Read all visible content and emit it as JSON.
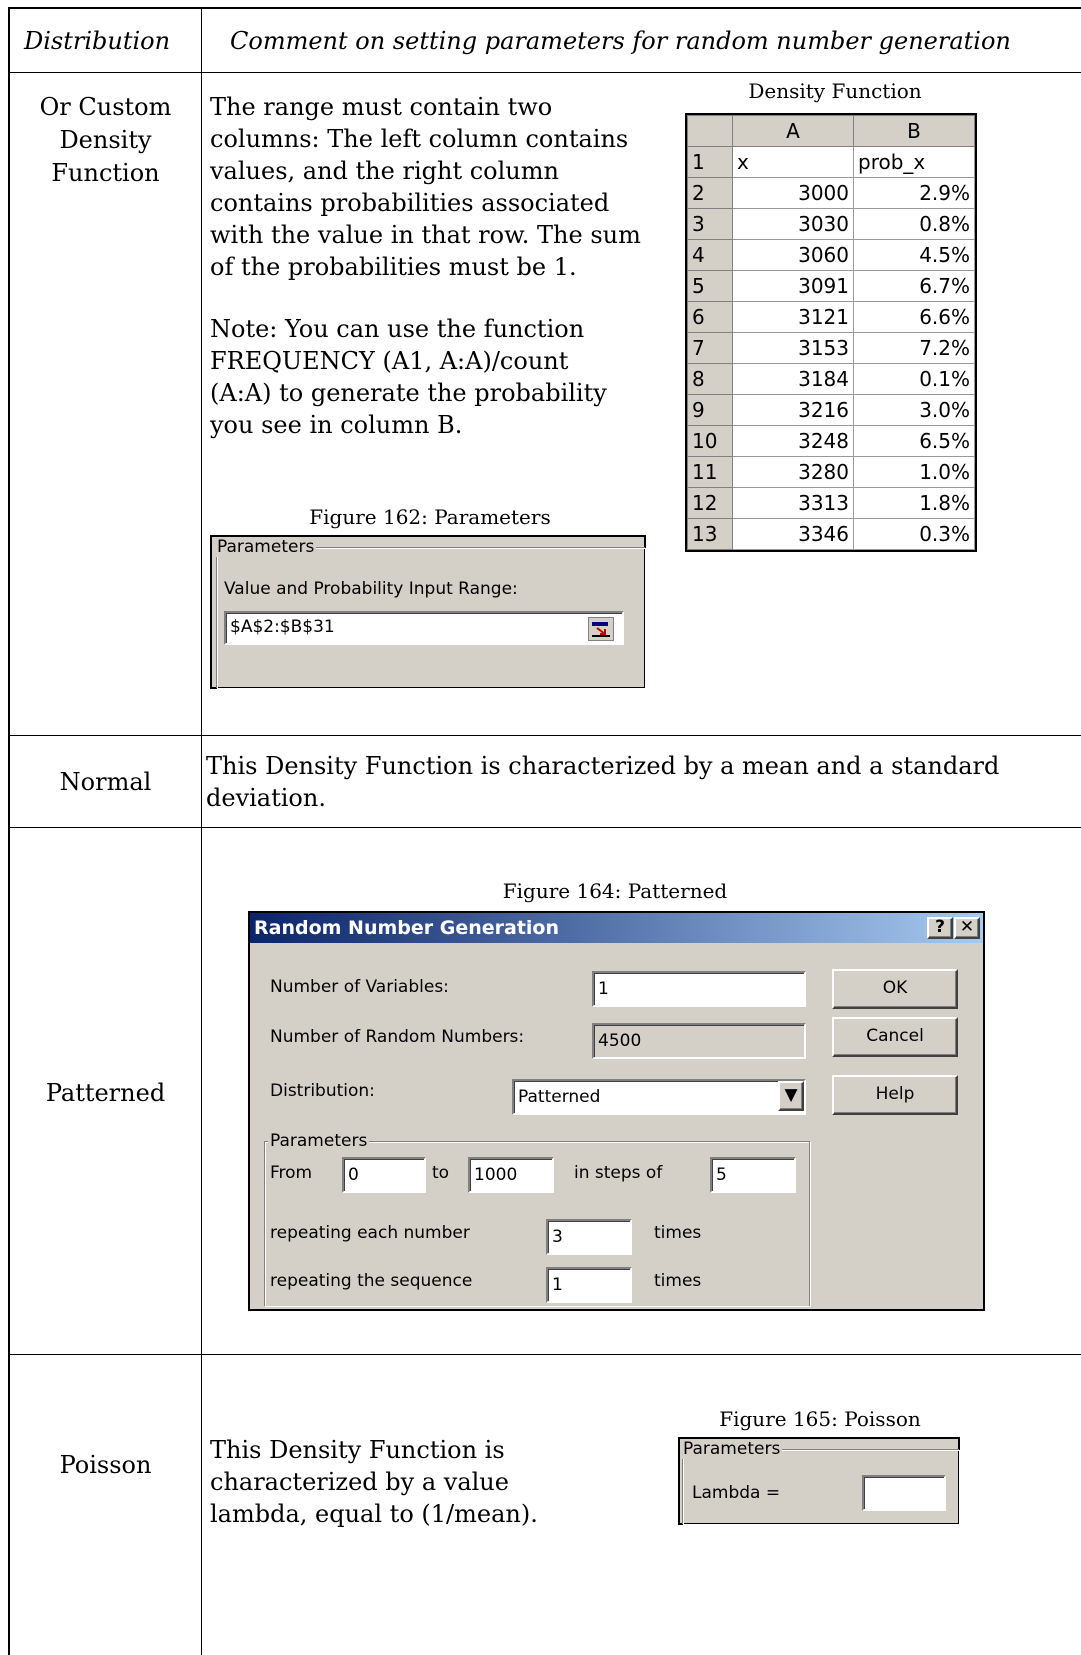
{
  "header": {
    "col1": "Distribution",
    "col2": "Comment on setting parameters for random number generation"
  },
  "custom": {
    "name_lines": [
      "Or Custom",
      "Density",
      "Function"
    ],
    "para1": "The range must contain two columns: The left column contains values, and the right column contains probabilities associated with the value in that row.  The sum of the probabilities must be 1.",
    "para2": "Note: You can use the function FREQUENCY (A1, A:A)/count (A:A) to generate the probability you see in column B.",
    "sheet_caption": "Density Function",
    "sheet": {
      "col_headers": [
        "A",
        "B"
      ],
      "rows": [
        {
          "n": "1",
          "a": "x",
          "b": "prob_x"
        },
        {
          "n": "2",
          "a": "3000",
          "b": "2.9%"
        },
        {
          "n": "3",
          "a": "3030",
          "b": "0.8%"
        },
        {
          "n": "4",
          "a": "3060",
          "b": "4.5%"
        },
        {
          "n": "5",
          "a": "3091",
          "b": "6.7%"
        },
        {
          "n": "6",
          "a": "3121",
          "b": "6.6%"
        },
        {
          "n": "7",
          "a": "3153",
          "b": "7.2%"
        },
        {
          "n": "8",
          "a": "3184",
          "b": "0.1%"
        },
        {
          "n": "9",
          "a": "3216",
          "b": "3.0%"
        },
        {
          "n": "10",
          "a": "3248",
          "b": "6.5%"
        },
        {
          "n": "11",
          "a": "3280",
          "b": "1.0%"
        },
        {
          "n": "12",
          "a": "3313",
          "b": "1.8%"
        },
        {
          "n": "13",
          "a": "3346",
          "b": "0.3%"
        }
      ]
    },
    "fig_caption": "Figure 162:  Parameters",
    "params_label": "Parameters",
    "range_label": "Value and Probability Input Range:",
    "range_value": "$A$2:$B$31"
  },
  "normal": {
    "name": "Normal",
    "text": "This Density Function is characterized by a mean and a standard deviation."
  },
  "patterned": {
    "name": "Patterned",
    "fig_caption": "Figure 164:  Patterned",
    "dialog": {
      "title": "Random Number Generation",
      "num_vars_label": "Number of Variables:",
      "num_vars_value": "1",
      "num_rand_label": "Number of Random Numbers:",
      "num_rand_value": "4500",
      "dist_label": "Distribution:",
      "dist_value": "Patterned",
      "ok": "OK",
      "cancel": "Cancel",
      "help": "Help",
      "params_label": "Parameters",
      "from_label": "From",
      "from_value": "0",
      "to_label": "to",
      "to_value": "1000",
      "steps_label": "in steps of",
      "steps_value": "5",
      "rep_each_label": "repeating each number",
      "rep_each_value": "3",
      "times1": "times",
      "rep_seq_label": "repeating the sequence",
      "rep_seq_value": "1",
      "times2": "times"
    }
  },
  "poisson": {
    "name": "Poisson",
    "text": "This Density Function is characterized by a value lambda, equal to (1/mean).",
    "fig_caption": "Figure 165:  Poisson",
    "params_label": "Parameters",
    "lambda_label": "Lambda ="
  }
}
